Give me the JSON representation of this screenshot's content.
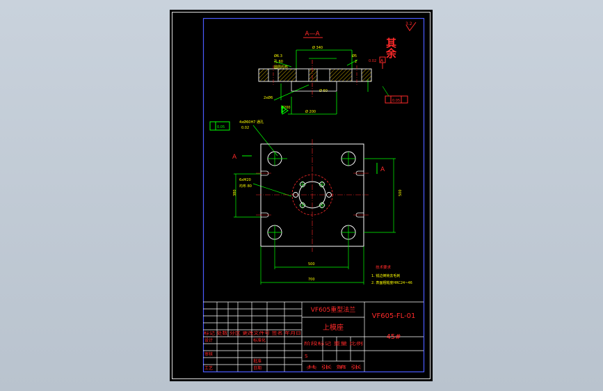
{
  "section_label": "A—A",
  "other_surfaces": {
    "text": "其余",
    "roughness": "3.2"
  },
  "section_dims": {
    "d1": "Ø 340",
    "d2": "Ø 200",
    "d3": "Ø 60",
    "left_a": "Ø6.3",
    "left_b": "孔 60",
    "left_c": "圆周均布",
    "right_a": "Ø5",
    "right_b": "2",
    "bottom_a": "2xØ6",
    "bottom_b": "Ø200"
  },
  "datum": {
    "letter": "A",
    "tol": "0.02"
  },
  "tolerance_frame": {
    "flatness": "0.05"
  },
  "plan_notes": {
    "top_a": "4xØ60H7 通孔",
    "top_b": "0.02",
    "mid_a": "6xM20",
    "mid_b": "均布 80"
  },
  "section_markers": {
    "left": "A",
    "right": "A"
  },
  "plan_dims": {
    "left_height": "380",
    "right_height": "500",
    "inner_width": "500",
    "outer_width": "700"
  },
  "tech_req": {
    "title": "技术要求",
    "items": [
      "1. 锐边倒钝去毛刺",
      "2. 表面粗糙度HRC24~46"
    ]
  },
  "title_block": {
    "product_name": "VF605重型法兰",
    "part_name": "上模座",
    "drawing_no": "VF605-FL-01",
    "material": "45#",
    "rev_header": "标记 处数 分区 更改文件号 签名 年月日",
    "designer": "设计",
    "standardize": "标准化",
    "stage_header": "阶段标记 重量 比例",
    "stage_mark": "S",
    "review": "审核",
    "process": "工艺",
    "check": "批准",
    "approve": "日期",
    "sheet_info": "共  张  第  张"
  }
}
